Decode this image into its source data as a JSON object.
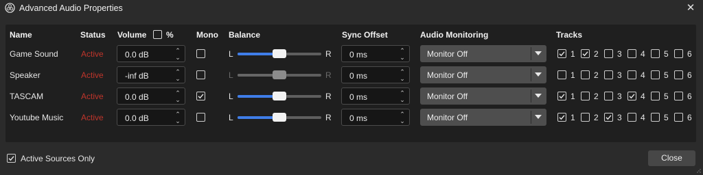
{
  "window": {
    "title": "Advanced Audio Properties"
  },
  "headers": {
    "name": "Name",
    "status": "Status",
    "volume": "Volume",
    "percent": "%",
    "mono": "Mono",
    "balance": "Balance",
    "sync_offset": "Sync Offset",
    "audio_monitoring": "Audio Monitoring",
    "tracks": "Tracks"
  },
  "balance_labels": {
    "left": "L",
    "right": "R"
  },
  "track_numbers": [
    "1",
    "2",
    "3",
    "4",
    "5",
    "6"
  ],
  "sources": [
    {
      "name": "Game Sound",
      "status": "Active",
      "volume": "0.0 dB",
      "mono": false,
      "balance": 0.5,
      "balance_enabled": true,
      "sync": "0 ms",
      "monitoring": "Monitor Off",
      "tracks": [
        true,
        true,
        false,
        false,
        false,
        false
      ]
    },
    {
      "name": "Speaker",
      "status": "Active",
      "volume": "-inf dB",
      "mono": false,
      "balance": 0.5,
      "balance_enabled": false,
      "sync": "0 ms",
      "monitoring": "Monitor Off",
      "tracks": [
        false,
        false,
        false,
        false,
        false,
        false
      ]
    },
    {
      "name": "TASCAM",
      "status": "Active",
      "volume": "0.0 dB",
      "mono": true,
      "balance": 0.5,
      "balance_enabled": true,
      "sync": "0 ms",
      "monitoring": "Monitor Off",
      "tracks": [
        true,
        false,
        false,
        true,
        false,
        false
      ]
    },
    {
      "name": "Youtube Music",
      "status": "Active",
      "volume": "0.0 dB",
      "mono": false,
      "balance": 0.5,
      "balance_enabled": true,
      "sync": "0 ms",
      "monitoring": "Monitor Off",
      "tracks": [
        true,
        false,
        true,
        false,
        false,
        false
      ]
    }
  ],
  "footer": {
    "active_only_label": "Active Sources Only",
    "active_only_checked": true,
    "close_label": "Close"
  },
  "colors": {
    "accent": "#3f7de8",
    "status_active": "#c0352b",
    "background": "#2b2b2b",
    "panel": "#1f1f1f"
  }
}
